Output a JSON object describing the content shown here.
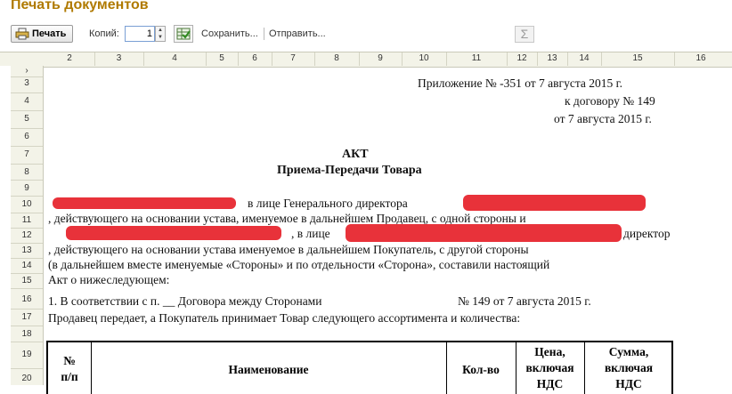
{
  "window": {
    "title": "Печать документов"
  },
  "toolbar": {
    "print_label": "Печать",
    "copies_label": "Копий:",
    "copies_value": "1",
    "save_label": "Сохранить...",
    "send_label": "Отправить...",
    "sum_label": "Σ"
  },
  "columns": [
    "2",
    "3",
    "4",
    "5",
    "6",
    "7",
    "8",
    "9",
    "10",
    "11",
    "12",
    "13",
    "14",
    "15",
    "16"
  ],
  "rows": [
    "3",
    "4",
    "5",
    "6",
    "7",
    "8",
    "9",
    "10",
    "11",
    "12",
    "13",
    "14",
    "15",
    "16",
    "17",
    "18",
    "19",
    "20"
  ],
  "document": {
    "appendix_line": "Приложение № -351   от 7 августа 2015 г.",
    "contract_line": "к договору № 149",
    "contract_date": "от 7 августа 2015 г.",
    "title": "АКТ",
    "subtitle": "Приема-Передачи Товара",
    "line10_mid": "в лице Генерального директора",
    "line11": ", действующего на основании устава, именуемое в дальнейшем Продавец, с одной стороны и",
    "line12_mid": ", в лице",
    "line12_end": "директор",
    "line13": ", действующего на основании устава именуемое в дальнейшем Покупатель, с другой стороны",
    "line14": "(в дальнейшем вместе именуемые «Стороны» и по отдельности «Сторона», составили настоящий",
    "line15": "Акт о нижеследующем:",
    "line16_left": "1. В соответствии с п. __ Договора между Сторонами",
    "line16_right": "№ 149 от 7 августа 2015 г.",
    "line17": "Продавец передает, а Покупатель принимает Товар следующего ассортимента и количества:"
  },
  "table": {
    "headers": {
      "num": [
        "№",
        "п/п"
      ],
      "name": "Наименование",
      "qty": "Кол-во",
      "price": [
        "Цена,",
        "включая",
        "НДС"
      ],
      "sum": [
        "Сумма,",
        "включая",
        "НДС"
      ]
    }
  },
  "colors": {
    "title": "#b07a00",
    "redaction": "#e8323a",
    "header_bg": "#f3f3e8"
  }
}
